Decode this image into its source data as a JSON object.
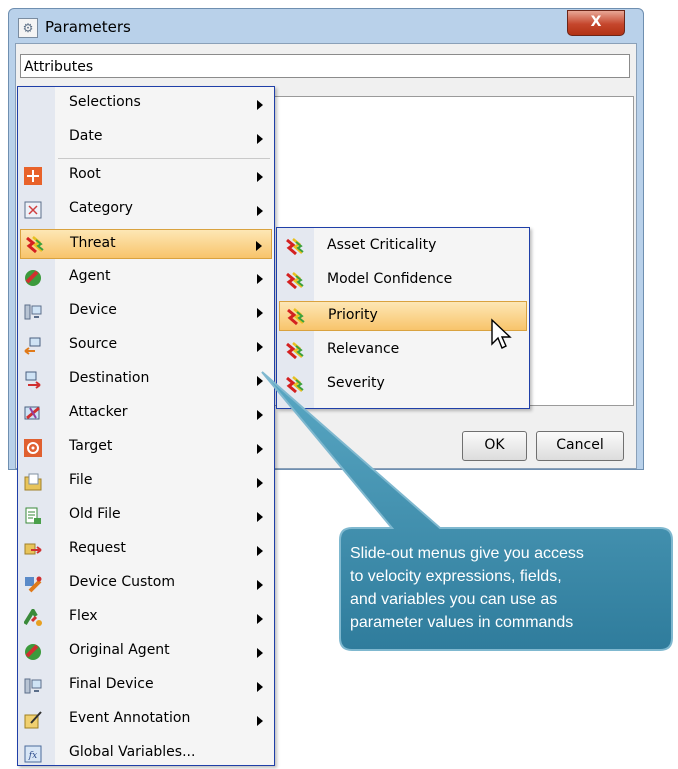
{
  "window": {
    "title": "Parameters",
    "close_label": "X"
  },
  "attributes_field": {
    "value": "Attributes"
  },
  "buttons": {
    "ok": "OK",
    "cancel": "Cancel"
  },
  "menu": {
    "items": [
      {
        "label": "Selections",
        "icon": "none",
        "submenu": true
      },
      {
        "label": "Date",
        "icon": "none",
        "submenu": true
      },
      {
        "label": "Root",
        "icon": "root-icon",
        "submenu": true
      },
      {
        "label": "Category",
        "icon": "category-icon",
        "submenu": true
      },
      {
        "label": "Threat",
        "icon": "threat-icon",
        "submenu": true,
        "highlighted": true
      },
      {
        "label": "Agent",
        "icon": "agent-icon",
        "submenu": true
      },
      {
        "label": "Device",
        "icon": "device-icon",
        "submenu": true
      },
      {
        "label": "Source",
        "icon": "source-icon",
        "submenu": true
      },
      {
        "label": "Destination",
        "icon": "destination-icon",
        "submenu": true
      },
      {
        "label": "Attacker",
        "icon": "attacker-icon",
        "submenu": true
      },
      {
        "label": "Target",
        "icon": "target-icon",
        "submenu": true
      },
      {
        "label": "File",
        "icon": "file-icon",
        "submenu": true
      },
      {
        "label": "Old File",
        "icon": "old-file-icon",
        "submenu": true
      },
      {
        "label": "Request",
        "icon": "request-icon",
        "submenu": true
      },
      {
        "label": "Device Custom",
        "icon": "device-custom-icon",
        "submenu": true
      },
      {
        "label": "Flex",
        "icon": "flex-icon",
        "submenu": true
      },
      {
        "label": "Original Agent",
        "icon": "original-agent-icon",
        "submenu": true
      },
      {
        "label": "Final Device",
        "icon": "final-device-icon",
        "submenu": true
      },
      {
        "label": "Event Annotation",
        "icon": "event-annotation-icon",
        "submenu": true
      },
      {
        "label": "Global Variables...",
        "icon": "global-variables-icon",
        "submenu": false
      }
    ]
  },
  "submenu": {
    "items": [
      {
        "label": "Asset Criticality",
        "icon": "threat-icon"
      },
      {
        "label": "Model Confidence",
        "icon": "threat-icon"
      },
      {
        "label": "Priority",
        "icon": "threat-icon",
        "highlighted": true
      },
      {
        "label": "Relevance",
        "icon": "threat-icon"
      },
      {
        "label": "Severity",
        "icon": "threat-icon"
      }
    ]
  },
  "callout": {
    "line1": "Slide-out menus give you access",
    "line2": "to velocity expressions, fields,",
    "line3": "and variables you can use as",
    "line4": "parameter values in commands"
  },
  "colors": {
    "menu_border": "#1f3fa8",
    "highlight": "#f8c46b",
    "callout_fill": "#3e8eab"
  }
}
